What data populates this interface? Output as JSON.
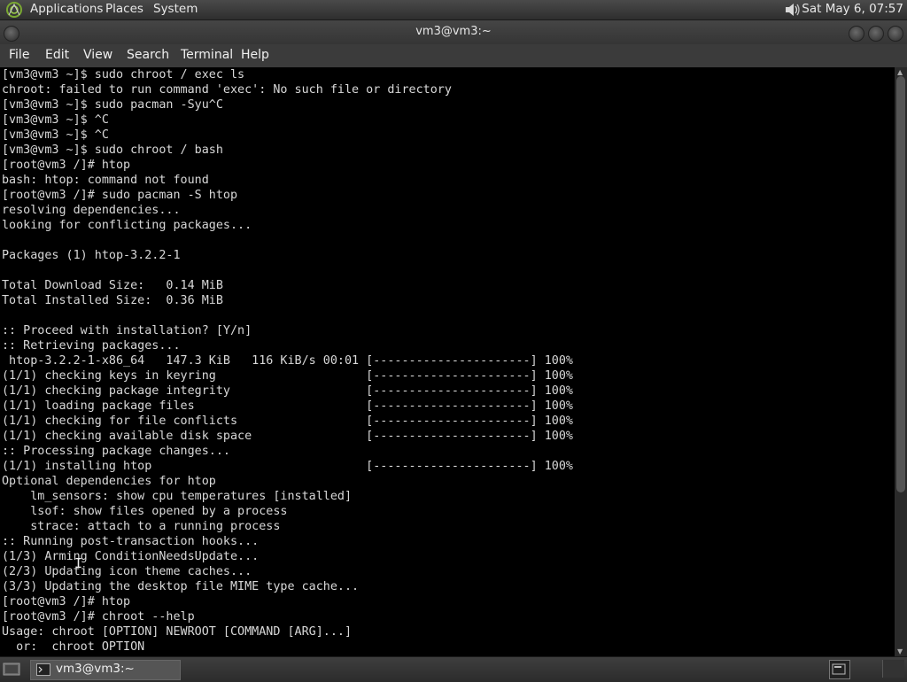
{
  "top_panel": {
    "menus": [
      "Applications",
      "Places",
      "System"
    ],
    "clock": "Sat May  6, 07:57"
  },
  "window": {
    "title": "vm3@vm3:~",
    "menubar": [
      "File",
      "Edit",
      "View",
      "Search",
      "Terminal",
      "Help"
    ]
  },
  "terminal": {
    "lines": [
      "[vm3@vm3 ~]$ sudo chroot / exec ls",
      "chroot: failed to run command 'exec': No such file or directory",
      "[vm3@vm3 ~]$ sudo pacman -Syu^C",
      "[vm3@vm3 ~]$ ^C",
      "[vm3@vm3 ~]$ ^C",
      "[vm3@vm3 ~]$ sudo chroot / bash",
      "[root@vm3 /]# htop",
      "bash: htop: command not found",
      "[root@vm3 /]# sudo pacman -S htop",
      "resolving dependencies...",
      "looking for conflicting packages...",
      "",
      "Packages (1) htop-3.2.2-1",
      "",
      "Total Download Size:   0.14 MiB",
      "Total Installed Size:  0.36 MiB",
      "",
      ":: Proceed with installation? [Y/n]",
      ":: Retrieving packages...",
      " htop-3.2.2-1-x86_64   147.3 KiB   116 KiB/s 00:01 [----------------------] 100%",
      "(1/1) checking keys in keyring                     [----------------------] 100%",
      "(1/1) checking package integrity                   [----------------------] 100%",
      "(1/1) loading package files                        [----------------------] 100%",
      "(1/1) checking for file conflicts                  [----------------------] 100%",
      "(1/1) checking available disk space                [----------------------] 100%",
      ":: Processing package changes...",
      "(1/1) installing htop                              [----------------------] 100%",
      "Optional dependencies for htop",
      "    lm_sensors: show cpu temperatures [installed]",
      "    lsof: show files opened by a process",
      "    strace: attach to a running process",
      ":: Running post-transaction hooks...",
      "(1/3) Arming ConditionNeedsUpdate...",
      "(2/3) Updating icon theme caches...",
      "(3/3) Updating the desktop file MIME type cache...",
      "[root@vm3 /]# htop",
      "[root@vm3 /]# chroot --help",
      "Usage: chroot [OPTION] NEWROOT [COMMAND [ARG]...]",
      "  or:  chroot OPTION"
    ]
  },
  "taskbar": {
    "task_label": "vm3@vm3:~"
  },
  "icons": {
    "distro": "distro-logo-icon",
    "volume": "volume-icon",
    "terminal": "terminal-icon",
    "show_desktop": "show-desktop-icon"
  }
}
